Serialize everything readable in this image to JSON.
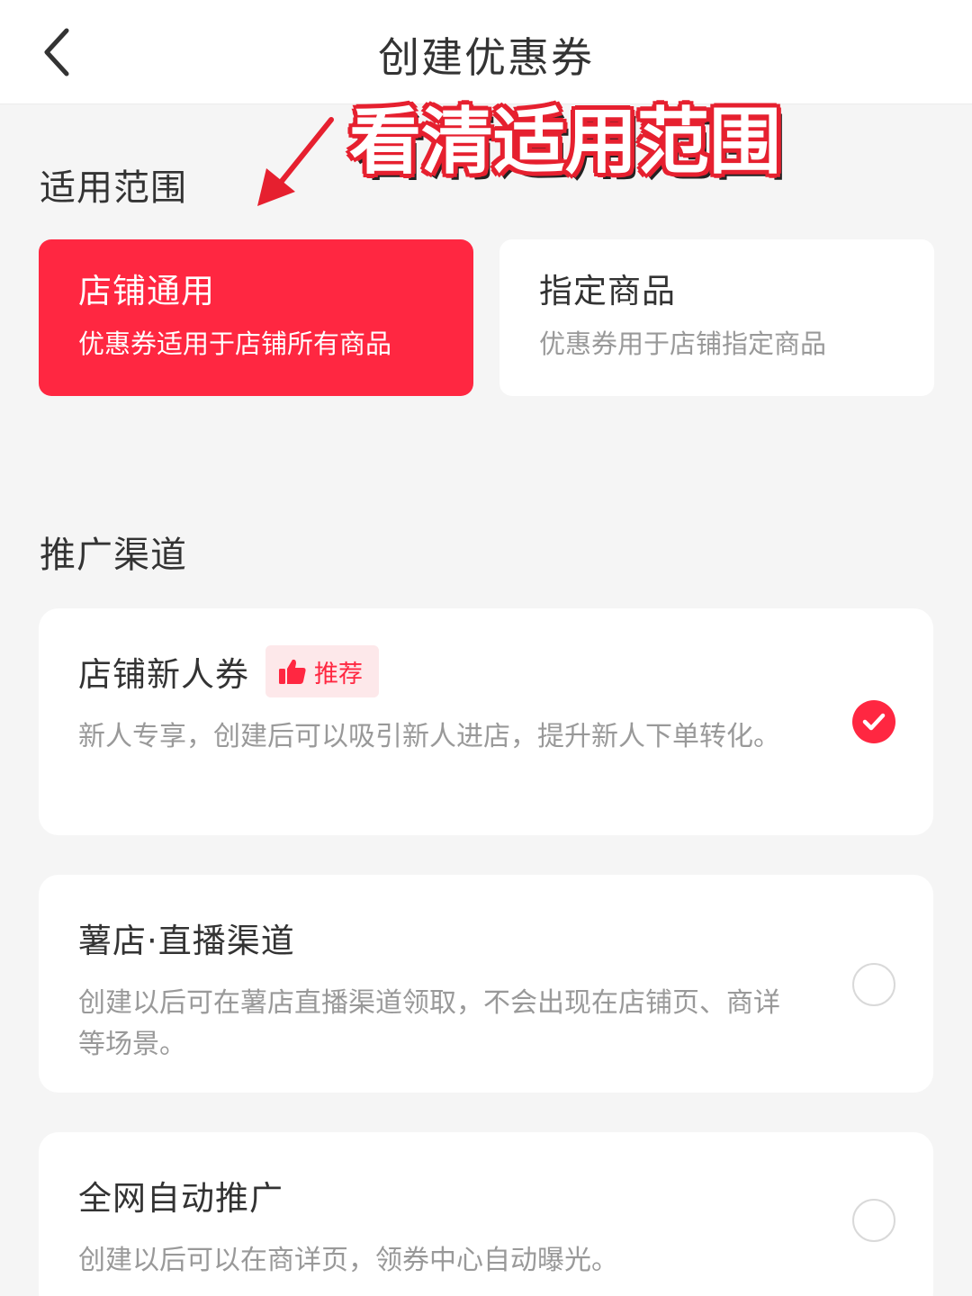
{
  "header": {
    "title": "创建优惠券"
  },
  "annotation": {
    "text": "看清适用范围"
  },
  "scope": {
    "title": "适用范围",
    "options": [
      {
        "title": "店铺通用",
        "desc": "优惠券适用于店铺所有商品",
        "selected": true
      },
      {
        "title": "指定商品",
        "desc": "优惠券用于店铺指定商品",
        "selected": false
      }
    ]
  },
  "channel": {
    "title": "推广渠道",
    "options": [
      {
        "title": "店铺新人券",
        "badge": "推荐",
        "desc": "新人专享，创建后可以吸引新人进店，提升新人下单转化。",
        "checked": true
      },
      {
        "title": "薯店·直播渠道",
        "desc": "创建以后可在薯店直播渠道领取，不会出现在店铺页、商详等场景。",
        "checked": false
      },
      {
        "title": "全网自动推广",
        "desc": "创建以后可以在商详页，领券中心自动曝光。",
        "checked": false
      }
    ]
  },
  "colors": {
    "accent": "#ff2741",
    "annotation": "#e6202f",
    "badge_bg": "#fde8ea"
  },
  "icons": {
    "back": "chevron-left-icon",
    "badge": "thumbs-up-icon",
    "check": "check-icon"
  }
}
